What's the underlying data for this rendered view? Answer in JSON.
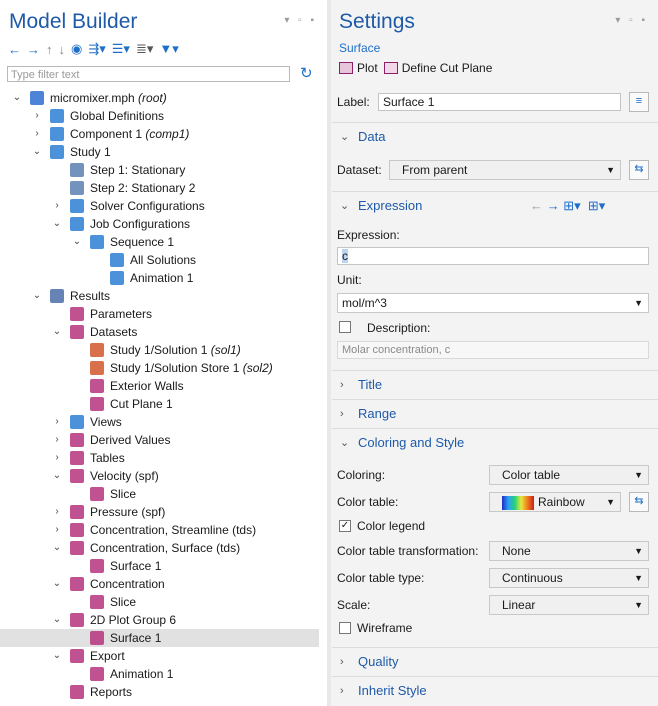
{
  "model_builder": {
    "title": "Model Builder",
    "filter_placeholder": "Type filter text",
    "tree": [
      {
        "label": "micromixer.mph",
        "tag": "(root)"
      },
      {
        "label": "Global Definitions",
        "tag": ""
      },
      {
        "label": "Component 1",
        "tag": "(comp1)"
      },
      {
        "label": "Study 1",
        "tag": ""
      },
      {
        "label": "Step 1: Stationary",
        "tag": ""
      },
      {
        "label": "Step 2: Stationary 2",
        "tag": ""
      },
      {
        "label": "Solver Configurations",
        "tag": ""
      },
      {
        "label": "Job Configurations",
        "tag": ""
      },
      {
        "label": "Sequence 1",
        "tag": ""
      },
      {
        "label": "All Solutions",
        "tag": ""
      },
      {
        "label": "Animation 1",
        "tag": ""
      },
      {
        "label": "Results",
        "tag": ""
      },
      {
        "label": "Parameters",
        "tag": ""
      },
      {
        "label": "Datasets",
        "tag": ""
      },
      {
        "label": "Study 1/Solution 1",
        "tag": "(sol1)"
      },
      {
        "label": "Study 1/Solution Store 1",
        "tag": "(sol2)"
      },
      {
        "label": "Exterior Walls",
        "tag": ""
      },
      {
        "label": "Cut Plane 1",
        "tag": ""
      },
      {
        "label": "Views",
        "tag": ""
      },
      {
        "label": "Derived Values",
        "tag": ""
      },
      {
        "label": "Tables",
        "tag": ""
      },
      {
        "label": "Velocity (spf)",
        "tag": ""
      },
      {
        "label": "Slice",
        "tag": ""
      },
      {
        "label": "Pressure (spf)",
        "tag": ""
      },
      {
        "label": "Concentration, Streamline (tds)",
        "tag": ""
      },
      {
        "label": "Concentration, Surface (tds)",
        "tag": ""
      },
      {
        "label": "Surface 1",
        "tag": ""
      },
      {
        "label": "Concentration",
        "tag": ""
      },
      {
        "label": "Slice",
        "tag": ""
      },
      {
        "label": "2D Plot Group 6",
        "tag": ""
      },
      {
        "label": "Surface 1",
        "tag": ""
      },
      {
        "label": "Export",
        "tag": ""
      },
      {
        "label": "Animation 1",
        "tag": ""
      },
      {
        "label": "Reports",
        "tag": ""
      }
    ]
  },
  "settings": {
    "title": "Settings",
    "subtitle": "Surface",
    "plot_label": "Plot",
    "define_cut_plane_label": "Define Cut Plane",
    "label_caption": "Label:",
    "label_value": "Surface 1",
    "sections": {
      "data": "Data",
      "expression": "Expression",
      "title": "Title",
      "range": "Range",
      "coloring_and_style": "Coloring and Style",
      "quality": "Quality",
      "inherit_style": "Inherit Style"
    },
    "dataset_caption": "Dataset:",
    "dataset_value": "From parent",
    "expression_caption": "Expression:",
    "expression_value": "c",
    "unit_caption": "Unit:",
    "unit_value": "mol/m^3",
    "description_caption": "Description:",
    "description_value": "Molar concentration, c",
    "coloring_caption": "Coloring:",
    "coloring_value": "Color table",
    "color_table_caption": "Color table:",
    "color_table_value": "Rainbow",
    "color_legend_label": "Color legend",
    "color_table_transformation_caption": "Color table transformation:",
    "color_table_transformation_value": "None",
    "color_table_type_caption": "Color table type:",
    "color_table_type_value": "Continuous",
    "scale_caption": "Scale:",
    "scale_value": "Linear",
    "wireframe_label": "Wireframe"
  },
  "colors": {
    "accent": "#1e5aa8",
    "plot_magenta": "#b5347e",
    "selection": "#e1e1e1"
  }
}
